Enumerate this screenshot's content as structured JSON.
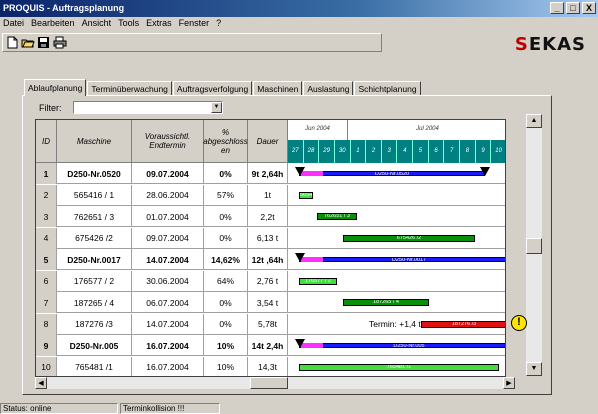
{
  "window": {
    "title": "PROQUIS - Auftragsplanung",
    "buttons": [
      "_",
      "□",
      "X"
    ]
  },
  "menu": [
    "Datei",
    "Bearbeiten",
    "Ansicht",
    "Tools",
    "Extras",
    "Fenster",
    "?"
  ],
  "toolbar": {
    "icons": [
      "new-file-icon",
      "open-folder-icon",
      "save-icon",
      "print-icon"
    ]
  },
  "logo": {
    "text_a": "S",
    "text_b": "EKAS"
  },
  "tabs": [
    "Ablaufplanung",
    "Terminüberwachung",
    "Auftragsverfolgung",
    "Maschinen",
    "Auslastung",
    "Schichtplanung"
  ],
  "filter": {
    "label": "Filter:",
    "value": ""
  },
  "table": {
    "headers": {
      "id": "ID",
      "maschine": "Maschine",
      "termin": "Voraussichtl. Endtermin",
      "pct": "% abgeschloss en",
      "dauer": "Dauer"
    },
    "months": [
      "Jun 2004",
      "Jul 2004"
    ],
    "days": [
      "27",
      "28",
      "29",
      "30",
      "1",
      "2",
      "3",
      "4",
      "5",
      "6",
      "7",
      "8",
      "9",
      "10"
    ],
    "rows": [
      {
        "id": "1",
        "maschine": "D250-Nr.0520",
        "termin": "09.07.2004",
        "pct": "0%",
        "dauer": "9t 2,64h",
        "bold": true
      },
      {
        "id": "2",
        "maschine": "565416 / 1",
        "termin": "28.06.2004",
        "pct": "57%",
        "dauer": "1t",
        "bold": false
      },
      {
        "id": "3",
        "maschine": "762651 / 3",
        "termin": "01.07.2004",
        "pct": "0%",
        "dauer": "2,2t",
        "bold": false
      },
      {
        "id": "4",
        "maschine": "675426 /2",
        "termin": "09.07.2004",
        "pct": "0%",
        "dauer": "6,13 t",
        "bold": false
      },
      {
        "id": "5",
        "maschine": "D250-Nr.0017",
        "termin": "14.07.2004",
        "pct": "14,62%",
        "dauer": "12t ,64h",
        "bold": true
      },
      {
        "id": "6",
        "maschine": "176577 / 2",
        "termin": "30.06.2004",
        "pct": "64%",
        "dauer": "2,76 t",
        "bold": false
      },
      {
        "id": "7",
        "maschine": "187265 / 4",
        "termin": "06.07.2004",
        "pct": "0%",
        "dauer": "3,54 t",
        "bold": false
      },
      {
        "id": "8",
        "maschine": "187276 /3",
        "termin": "14.07.2004",
        "pct": "0%",
        "dauer": "5,78t",
        "bold": false
      },
      {
        "id": "9",
        "maschine": "D250-Nr.005",
        "termin": "16.07.2004",
        "pct": "10%",
        "dauer": "14t 2,4h",
        "bold": true
      },
      {
        "id": "10",
        "maschine": "765481 /1",
        "termin": "16.07.2004",
        "pct": "10%",
        "dauer": "14,3t",
        "bold": false
      }
    ]
  },
  "gantt": {
    "bars": [
      {
        "row": 0,
        "label": "D250-Nr.0520",
        "color": "#1a1aff",
        "kind": "summary"
      },
      {
        "row": 1,
        "label": "565416/1",
        "color": "#3ee03e",
        "kind": "task"
      },
      {
        "row": 2,
        "label": "762651 / 3",
        "color": "#0a8f0a",
        "kind": "task"
      },
      {
        "row": 3,
        "label": "675426 /2",
        "color": "#0a8f0a",
        "kind": "task"
      },
      {
        "row": 4,
        "label": "D250-Nr.0017",
        "color": "#1a1aff",
        "kind": "summary"
      },
      {
        "row": 5,
        "label": "176577 / 2",
        "color": "#3ee03e",
        "kind": "task"
      },
      {
        "row": 6,
        "label": "187265 / 4",
        "color": "#0a8f0a",
        "kind": "task"
      },
      {
        "row": 7,
        "label": "187276 /3",
        "color": "#e01010",
        "kind": "task"
      },
      {
        "row": 8,
        "label": "D250-Nr.005",
        "color": "#1a1aff",
        "kind": "summary"
      },
      {
        "row": 9,
        "label": "765481 /1",
        "color": "#3ee03e",
        "kind": "task"
      }
    ],
    "conflict_text": "Termin: +1,4 t"
  },
  "status": {
    "state": "Status: online",
    "message": "Terminkollision !!!"
  }
}
